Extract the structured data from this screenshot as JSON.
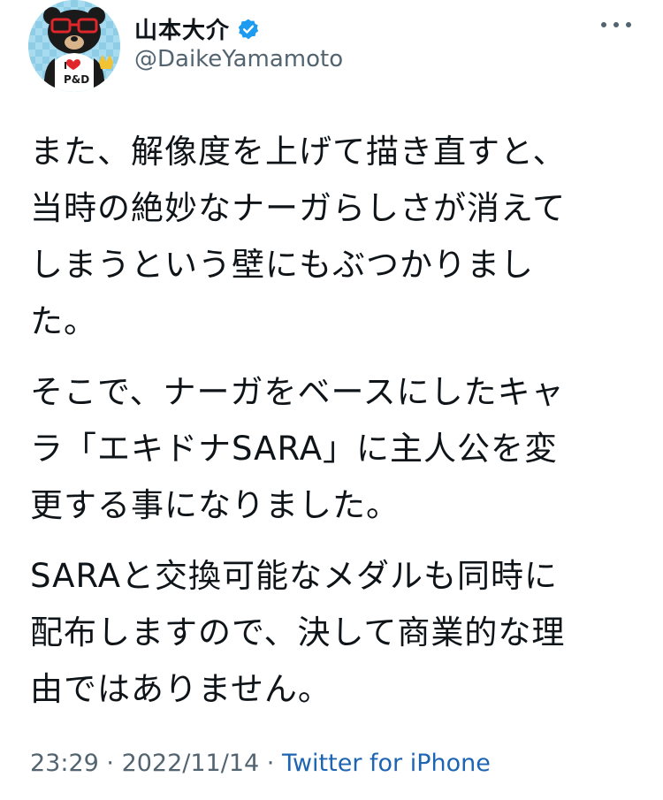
{
  "header": {
    "display_name": "山本大介",
    "handle": "@DaikeYamamoto",
    "avatar_text": "I ♥ P&D",
    "verified_icon": "verified-badge-icon",
    "more_icon": "more-horizontal-icon"
  },
  "tweet": {
    "paragraphs": [
      {
        "lines": [
          "また、解像度を上げて描き直すと、",
          "当時の絶妙なナーガらしさが消えて",
          "しまうという壁にもぶつかりまし",
          "た。"
        ]
      },
      {
        "lines": [
          "そこで、ナーガをベースにしたキャ",
          "ラ「エキドナSARA」に主人公を変",
          "更する事になりました。"
        ]
      },
      {
        "lines": [
          "SARAと交換可能なメダルも同時に",
          "配布しますので、決して商業的な理",
          "由ではありません。"
        ]
      }
    ]
  },
  "meta": {
    "time": "23:29",
    "separator": " · ",
    "date": "2022/11/14",
    "source": "Twitter for iPhone"
  },
  "colors": {
    "text": "#0f1419",
    "secondary": "#536471",
    "link": "#1d64b3",
    "verified": "#1d9bf0"
  }
}
